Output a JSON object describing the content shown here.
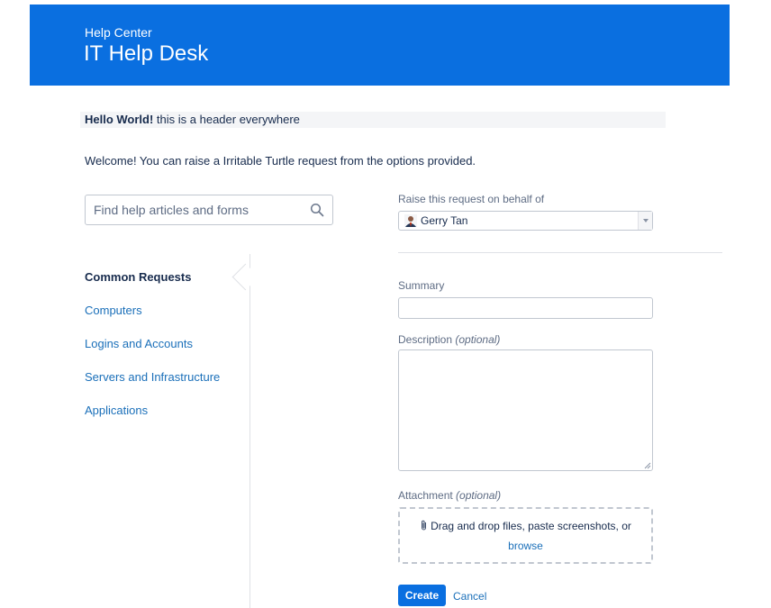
{
  "header": {
    "breadcrumb": "Help Center",
    "title": "IT Help Desk",
    "background_color": "#0a6fe0"
  },
  "announcement": {
    "bold": "Hello World!",
    "text": " this is a header everywhere"
  },
  "welcome_text": "Welcome! You can raise a Irritable Turtle request from the options provided.",
  "search": {
    "placeholder": "Find help articles and forms",
    "value": "",
    "icon": "search-icon"
  },
  "sidebar": {
    "heading": "Common Requests",
    "items": [
      {
        "label": "Computers"
      },
      {
        "label": "Logins and Accounts"
      },
      {
        "label": "Servers and Infrastructure"
      },
      {
        "label": "Applications"
      }
    ]
  },
  "form": {
    "on_behalf": {
      "label": "Raise this request on behalf of",
      "value": "Gerry Tan",
      "icon": "user-avatar-icon"
    },
    "summary": {
      "label": "Summary",
      "value": ""
    },
    "description": {
      "label": "Description",
      "optional": "(optional)",
      "value": ""
    },
    "attachment": {
      "label": "Attachment",
      "optional": "(optional)",
      "drop_text": "Drag and drop files, paste screenshots, or",
      "browse": "browse",
      "icon": "paperclip-icon"
    },
    "create_label": "Create",
    "cancel_label": "Cancel"
  },
  "colors": {
    "accent": "#0a6fe0",
    "link": "#1a6fb9"
  }
}
